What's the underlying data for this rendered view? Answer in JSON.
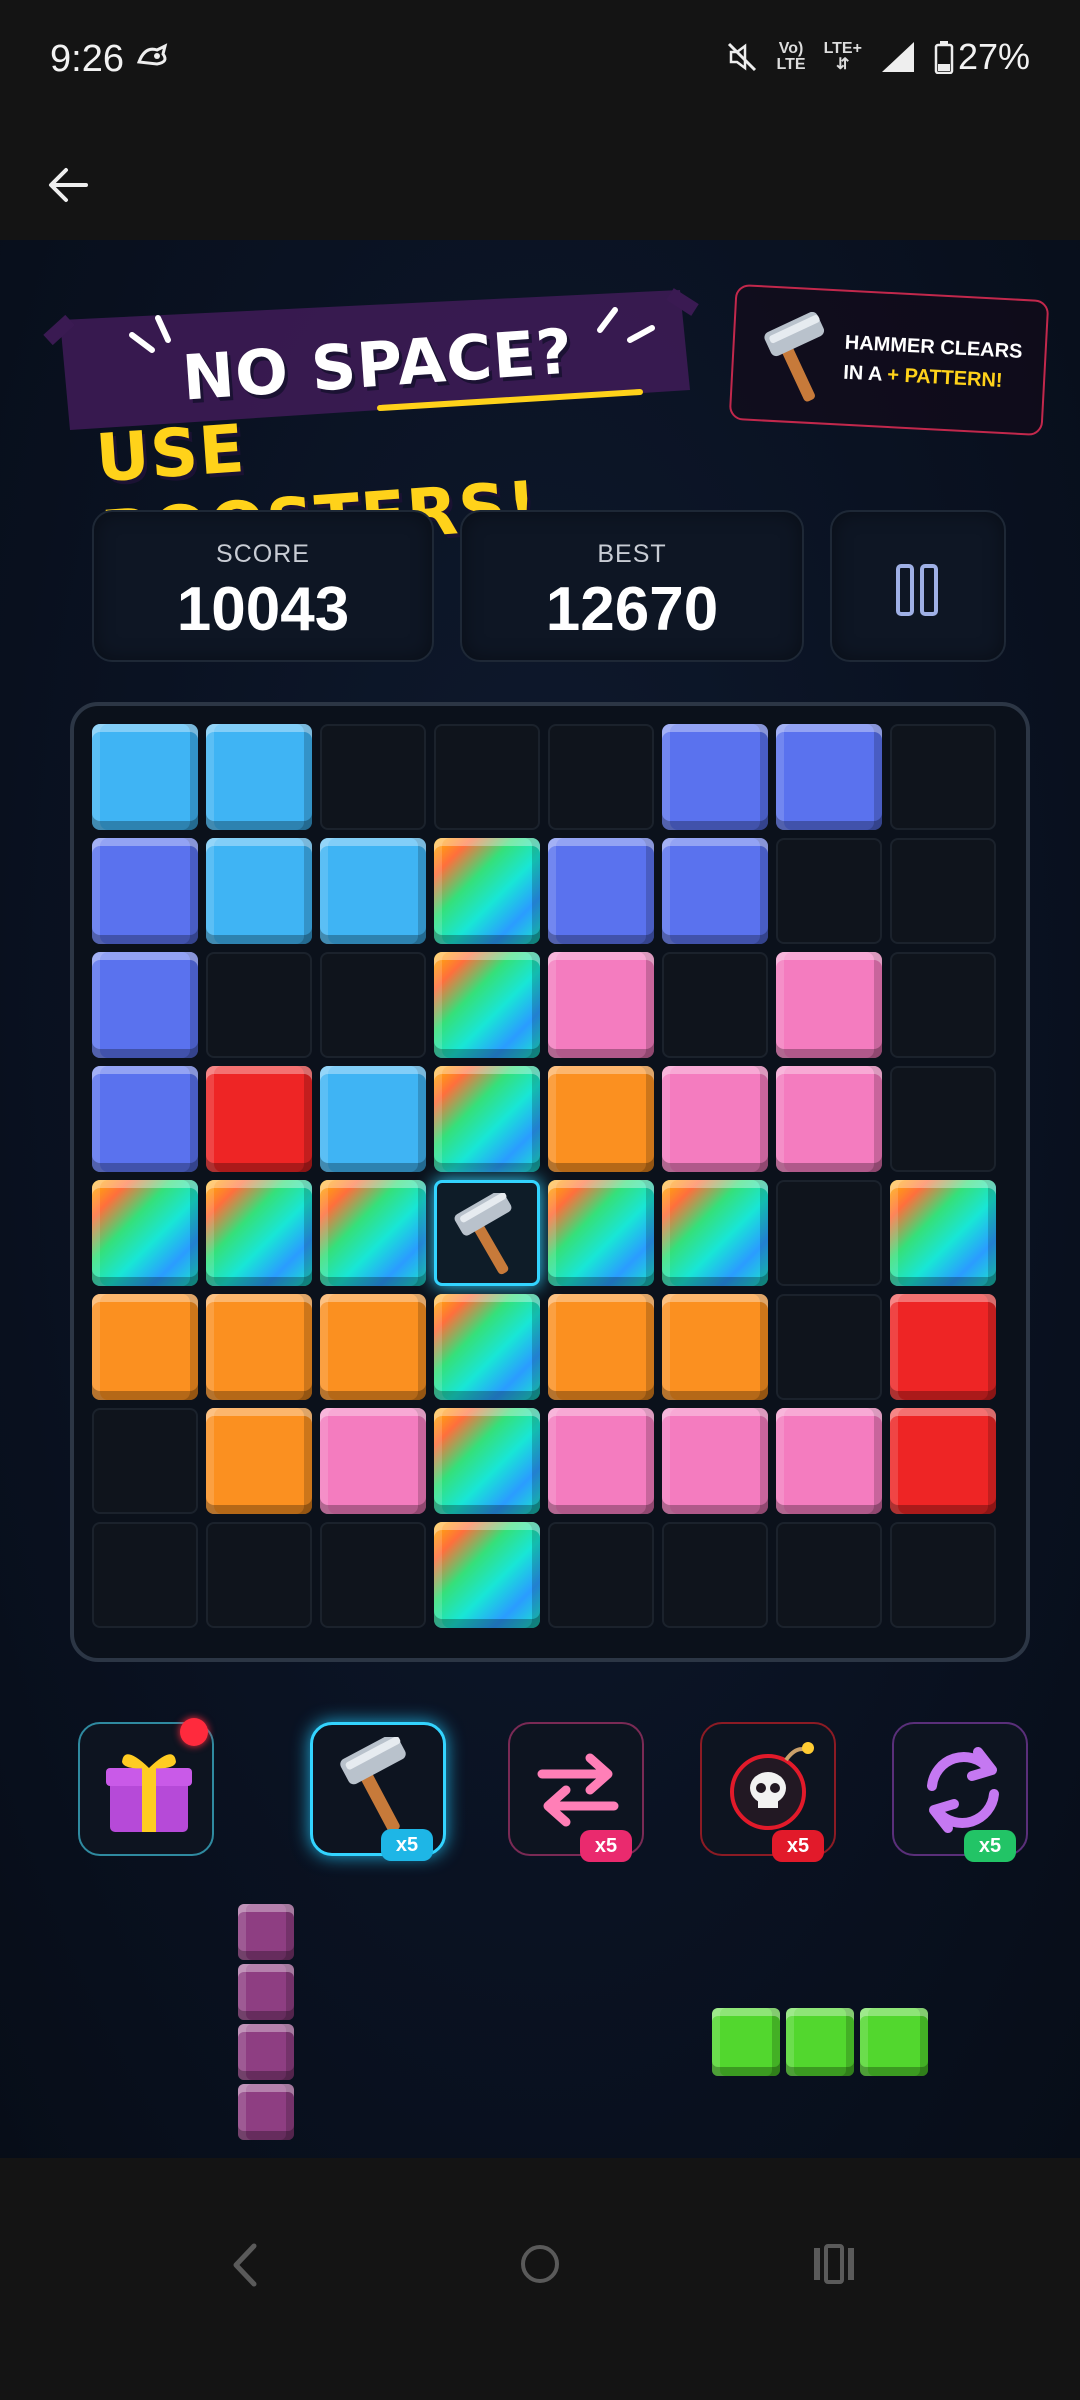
{
  "status_bar": {
    "time": "9:26",
    "net_top": "Vo)",
    "net_bottom": "LTE",
    "lte_plus": "LTE+",
    "battery": "27%"
  },
  "banner": {
    "line1": "NO SPACE?",
    "line2": "USE BOOSTERS!"
  },
  "tip": {
    "line1": "HAMMER CLEARS",
    "line2_prefix": "IN A ",
    "line2_highlight": "+ PATTERN!"
  },
  "score": {
    "label": "SCORE",
    "value": "10043"
  },
  "best": {
    "label": "BEST",
    "value": "12670"
  },
  "colors": {
    "cyan": "#3fb4f4",
    "blue": "#5a72ee",
    "pink": "#f47cbf",
    "orange": "#fb9020",
    "red": "#ee2525",
    "green": "#52d72e",
    "purple": "#8e3e82"
  },
  "board": {
    "rows": [
      [
        "cyan",
        "cyan",
        "empty",
        "empty",
        "empty",
        "blue",
        "blue",
        "empty"
      ],
      [
        "blue",
        "cyan",
        "cyan",
        "rainbow",
        "blue",
        "blue",
        "empty",
        "empty"
      ],
      [
        "blue",
        "empty",
        "empty",
        "rainbow",
        "pink",
        "empty",
        "pink",
        "empty"
      ],
      [
        "blue",
        "red",
        "cyan",
        "rainbow",
        "orange",
        "pink",
        "pink",
        "empty"
      ],
      [
        "rainbow",
        "rainbow",
        "rainbow",
        "hammer",
        "rainbow",
        "rainbow",
        "empty",
        "rainbow"
      ],
      [
        "orange",
        "orange",
        "orange",
        "rainbow",
        "orange",
        "orange",
        "empty",
        "red"
      ],
      [
        "empty",
        "orange",
        "pink",
        "rainbow",
        "pink",
        "pink",
        "pink",
        "red"
      ],
      [
        "empty",
        "empty",
        "empty",
        "rainbow",
        "empty",
        "empty",
        "empty",
        "empty"
      ]
    ]
  },
  "boosters": [
    {
      "name": "gift",
      "icon": "gift-icon",
      "badge": ""
    },
    {
      "name": "hammer",
      "icon": "hammer-icon",
      "badge": "x5"
    },
    {
      "name": "swap",
      "icon": "swap-arrows-icon",
      "badge": "x5"
    },
    {
      "name": "bomb",
      "icon": "skull-bomb-icon",
      "badge": "x5"
    },
    {
      "name": "refresh",
      "icon": "refresh-icon",
      "badge": "x5"
    }
  ],
  "pieces": [
    {
      "name": "vertical-four",
      "color": "purple"
    },
    {
      "name": "horizontal-three",
      "color": "green"
    }
  ]
}
